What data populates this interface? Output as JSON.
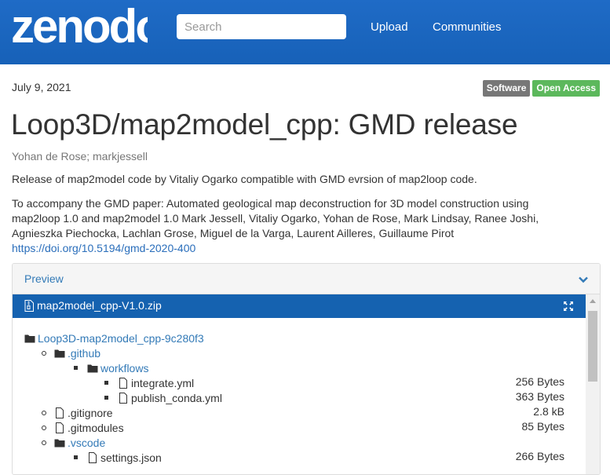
{
  "header": {
    "logo_text": "zenodo",
    "search_placeholder": "Search",
    "nav": [
      "Upload",
      "Communities"
    ]
  },
  "record": {
    "date": "July 9, 2021",
    "badges": [
      "Software",
      "Open Access"
    ],
    "title": "Loop3D/map2model_cpp: GMD release",
    "authors": "Yohan de Rose; markjessell",
    "description": "Release of map2model code by Vitaliy Ogarko compatible with GMD evrsion of map2loop code.",
    "description2_lines": [
      "To accompany the GMD paper: Automated geological map deconstruction for 3D model construction using",
      "map2loop 1.0 and map2model 1.0 Mark Jessell, Vitaliy Ogarko, Yohan de Rose, Mark Lindsay, Ranee Joshi,",
      "Agnieszka Piechocka, Lachlan Grose, Miguel de la Varga, Laurent Ailleres, Guillaume Pirot"
    ],
    "doi_link": "https://doi.org/10.5194/gmd-2020-400"
  },
  "preview": {
    "title": "Preview",
    "file_name": "map2model_cpp-V1.0.zip",
    "tree": [
      {
        "name": "Loop3D-map2model_cpp-9c280f3",
        "type": "folder",
        "depth": 0,
        "size": ""
      },
      {
        "name": ".github",
        "type": "folder",
        "depth": 1,
        "size": ""
      },
      {
        "name": "workflows",
        "type": "folder",
        "depth": 2,
        "size": ""
      },
      {
        "name": "integrate.yml",
        "type": "file",
        "depth": 3,
        "size": "256 Bytes"
      },
      {
        "name": "publish_conda.yml",
        "type": "file",
        "depth": 3,
        "size": "363 Bytes"
      },
      {
        "name": ".gitignore",
        "type": "file",
        "depth": 1,
        "size": "2.8 kB"
      },
      {
        "name": ".gitmodules",
        "type": "file",
        "depth": 1,
        "size": "85 Bytes"
      },
      {
        "name": ".vscode",
        "type": "folder",
        "depth": 1,
        "size": ""
      },
      {
        "name": "settings.json",
        "type": "file",
        "depth": 2,
        "size": "266 Bytes"
      }
    ]
  },
  "colors": {
    "header_blue": "#1f6bc6",
    "file_bar_blue": "#1562b0",
    "badge_software": "#777777",
    "badge_open_access": "#5cb85c",
    "link": "#337ab7"
  }
}
